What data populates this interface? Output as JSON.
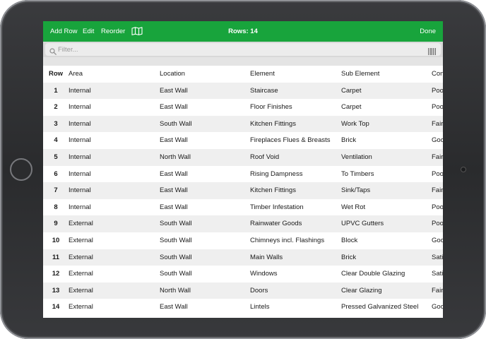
{
  "toolbar": {
    "add_row_label": "Add Row",
    "edit_label": "Edit",
    "reorder_label": "Reorder",
    "map_icon": "map-icon",
    "rows_label": "Rows: 14",
    "done_label": "Done",
    "color": "#18a43c"
  },
  "filter": {
    "placeholder": "Filter...",
    "value": "",
    "search_icon": "search-icon",
    "barcode_icon": "barcode-icon"
  },
  "table": {
    "headers": [
      "Row",
      "Area",
      "Location",
      "Element",
      "Sub Element",
      "Condition"
    ],
    "rows": [
      [
        "1",
        "Internal",
        "East Wall",
        "Staircase",
        "Carpet",
        "Poor"
      ],
      [
        "2",
        "Internal",
        "East Wall",
        "Floor Finishes",
        "Carpet",
        "Poor"
      ],
      [
        "3",
        "Internal",
        "South Wall",
        "Kitchen Fittings",
        "Work Top",
        "Fair"
      ],
      [
        "4",
        "Internal",
        "East Wall",
        "Fireplaces Flues & Breasts",
        "Brick",
        "Good"
      ],
      [
        "5",
        "Internal",
        "North Wall",
        "Roof Void",
        "Ventilation",
        "Fair"
      ],
      [
        "6",
        "Internal",
        "East Wall",
        "Rising Dampness",
        "To Timbers",
        "Poor"
      ],
      [
        "7",
        "Internal",
        "East Wall",
        "Kitchen Fittings",
        "Sink/Taps",
        "Fair"
      ],
      [
        "8",
        "Internal",
        "East Wall",
        "Timber Infestation",
        "Wet Rot",
        "Poor"
      ],
      [
        "9",
        "External",
        "South Wall",
        "Rainwater Goods",
        "UPVC Gutters",
        "Poor"
      ],
      [
        "10",
        "External",
        "South Wall",
        "Chimneys incl. Flashings",
        "Block",
        "Good"
      ],
      [
        "11",
        "External",
        "South Wall",
        "Main Walls",
        "Brick",
        "Satisfactory"
      ],
      [
        "12",
        "External",
        "South Wall",
        "Windows",
        "Clear Double Glazing",
        "Satisfactory"
      ],
      [
        "13",
        "External",
        "North Wall",
        "Doors",
        "Clear Glazing",
        "Fair"
      ],
      [
        "14",
        "External",
        "East Wall",
        "Lintels",
        "Pressed Galvanized Steel",
        "Good"
      ]
    ]
  }
}
